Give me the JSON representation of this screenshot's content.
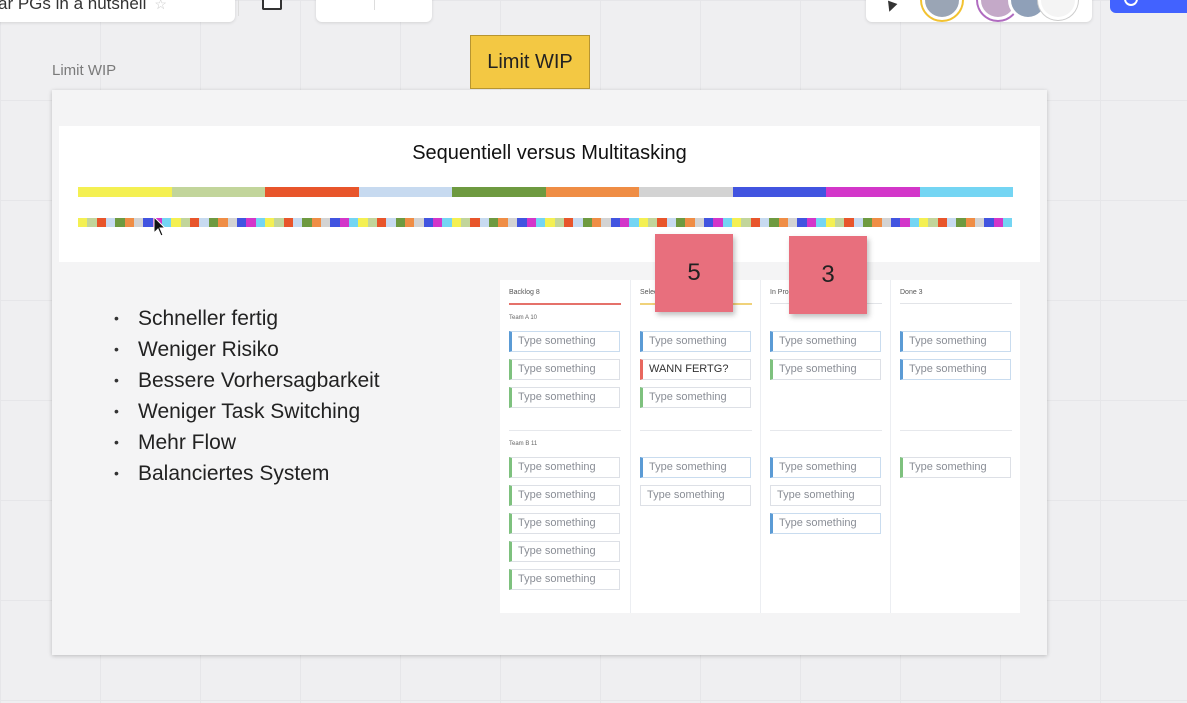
{
  "topbar": {
    "board_title": "ar PGs in a nutshell",
    "star": "☆"
  },
  "frame_label": "Limit WIP",
  "wip_sticky": "Limit WIP",
  "slide": {
    "title": "Sequentiell versus Multitasking",
    "seq_colors": [
      "#f4f052",
      "#c2d59b",
      "#e8552b",
      "#c7daf0",
      "#6e9a40",
      "#ef8d45",
      "#d3d3d3",
      "#4154e0",
      "#d336c9",
      "#74d5f3"
    ],
    "multi_colors": [
      "#f4f052",
      "#c2d59b",
      "#e8552b",
      "#c7daf0",
      "#6e9a40",
      "#ef8d45",
      "#d3d3d3",
      "#4154e0",
      "#d336c9",
      "#74d5f3"
    ]
  },
  "bullets": [
    "Schneller fertig",
    "Weniger Risiko",
    "Bessere Vorhersagbarkeit",
    "Weniger Task Switching",
    "Mehr Flow",
    "Balanciertes System"
  ],
  "kanban": {
    "columns": [
      {
        "header": "Backlog  8"
      },
      {
        "header": "Selec"
      },
      {
        "header": "In Pro"
      },
      {
        "header": "Done  3"
      }
    ],
    "team_a": "Team A  10",
    "team_b": "Team B  11",
    "card_placeholder": "Type something",
    "wann_card": "WANN FERTG?"
  },
  "wip_notes": [
    "5",
    "3"
  ]
}
